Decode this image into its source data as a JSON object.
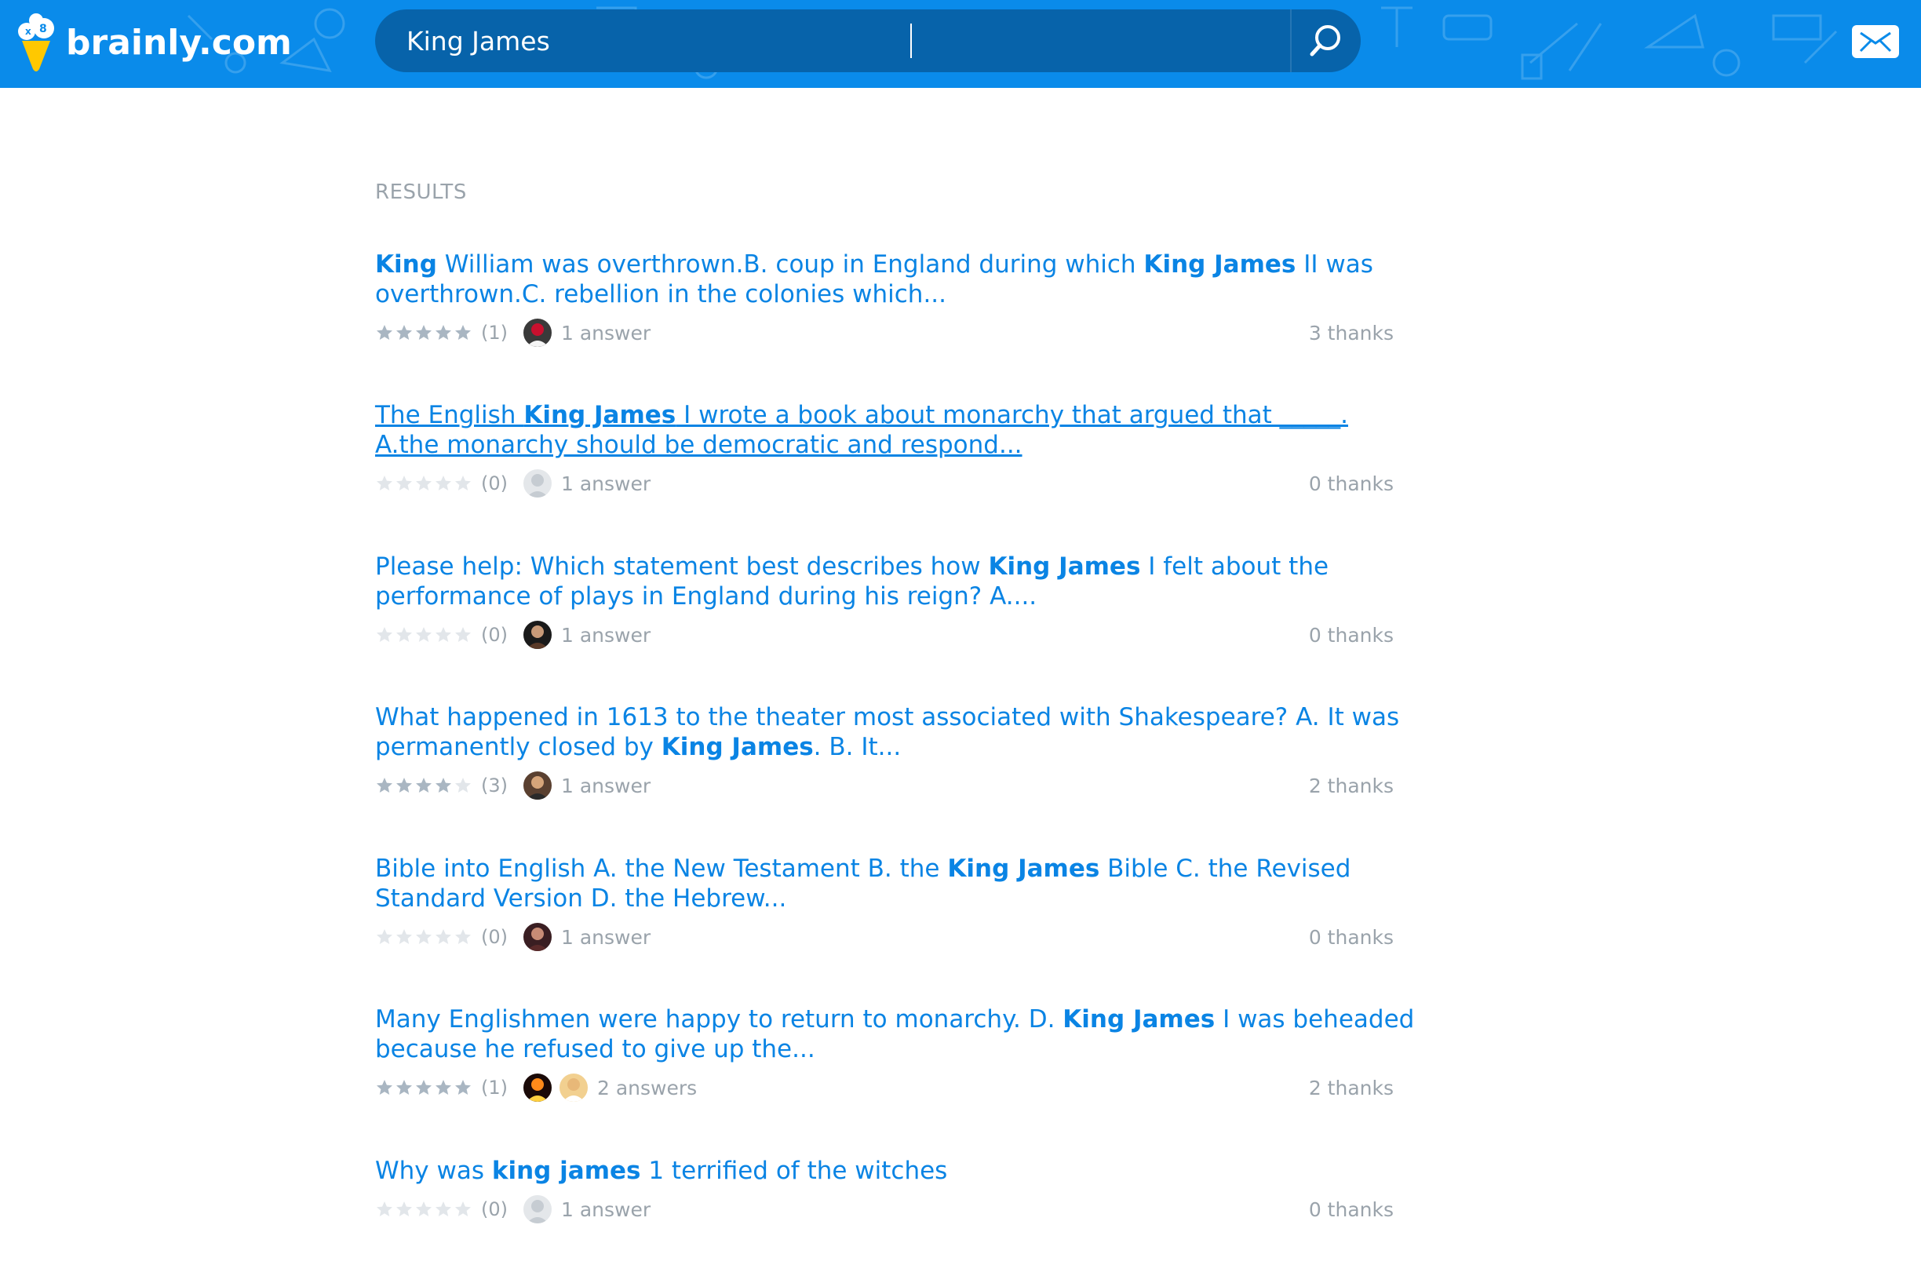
{
  "header": {
    "logo_text": "brainly.com",
    "search_value": "King James",
    "brand_color": "#0a8bea",
    "search_bg": "#0763aa"
  },
  "results_label": "RESULTS",
  "results": [
    {
      "title_parts": [
        {
          "text": "King",
          "bold": true
        },
        {
          "text": " William was overthrown.B. coup in England during which ",
          "bold": false
        },
        {
          "text": "King James",
          "bold": true
        },
        {
          "text": " II was overthrown.C. rebellion in the colonies which...",
          "bold": false
        }
      ],
      "stars_filled": 5,
      "rating_count": "(1)",
      "avatars": [
        "santa"
      ],
      "answers": "1 answer",
      "thanks": "3 thanks",
      "underlined": false
    },
    {
      "title_parts": [
        {
          "text": "The English ",
          "bold": false
        },
        {
          "text": "King James",
          "bold": true
        },
        {
          "text": " I wrote a book about monarchy that argued that _____. A.the monarchy should be democratic and respond...",
          "bold": false
        }
      ],
      "stars_filled": 0,
      "rating_count": "(0)",
      "avatars": [
        "default"
      ],
      "answers": "1 answer",
      "thanks": "0 thanks",
      "underlined": true
    },
    {
      "title_parts": [
        {
          "text": "Please help: Which statement best describes how ",
          "bold": false
        },
        {
          "text": "King James",
          "bold": true
        },
        {
          "text": " I felt about the performance of plays in England during his reign? A....",
          "bold": false
        }
      ],
      "stars_filled": 0,
      "rating_count": "(0)",
      "avatars": [
        "photo-dark"
      ],
      "answers": "1 answer",
      "thanks": "0 thanks",
      "underlined": false
    },
    {
      "title_parts": [
        {
          "text": "What happened in 1613 to the theater most associated with Shakespeare? A. It was permanently closed by ",
          "bold": false
        },
        {
          "text": "King James",
          "bold": true
        },
        {
          "text": ". B. It...",
          "bold": false
        }
      ],
      "stars_filled": 4,
      "rating_count": "(3)",
      "avatars": [
        "photo-warm"
      ],
      "answers": "1 answer",
      "thanks": "2 thanks",
      "underlined": false
    },
    {
      "title_parts": [
        {
          "text": "Bible into English A. the New Testament B. the ",
          "bold": false
        },
        {
          "text": "King James",
          "bold": true
        },
        {
          "text": " Bible C. the Revised Standard Version D. the Hebrew...",
          "bold": false
        }
      ],
      "stars_filled": 0,
      "rating_count": "(0)",
      "avatars": [
        "photo-girl"
      ],
      "answers": "1 answer",
      "thanks": "0 thanks",
      "underlined": false
    },
    {
      "title_parts": [
        {
          "text": "Many Englishmen were happy to return to monarchy. D. ",
          "bold": false
        },
        {
          "text": "King James",
          "bold": true
        },
        {
          "text": " I was beheaded because he refused to give up the...",
          "bold": false
        }
      ],
      "stars_filled": 5,
      "rating_count": "(1)",
      "avatars": [
        "photo-fire",
        "photo-blonde"
      ],
      "answers": "2 answers",
      "thanks": "2 thanks",
      "underlined": false
    },
    {
      "title_parts": [
        {
          "text": "Why was ",
          "bold": false
        },
        {
          "text": "king james",
          "bold": true
        },
        {
          "text": " 1 terrified of the witches",
          "bold": false
        }
      ],
      "stars_filled": 0,
      "rating_count": "(0)",
      "avatars": [
        "default"
      ],
      "answers": "1 answer",
      "thanks": "0 thanks",
      "underlined": false
    }
  ]
}
